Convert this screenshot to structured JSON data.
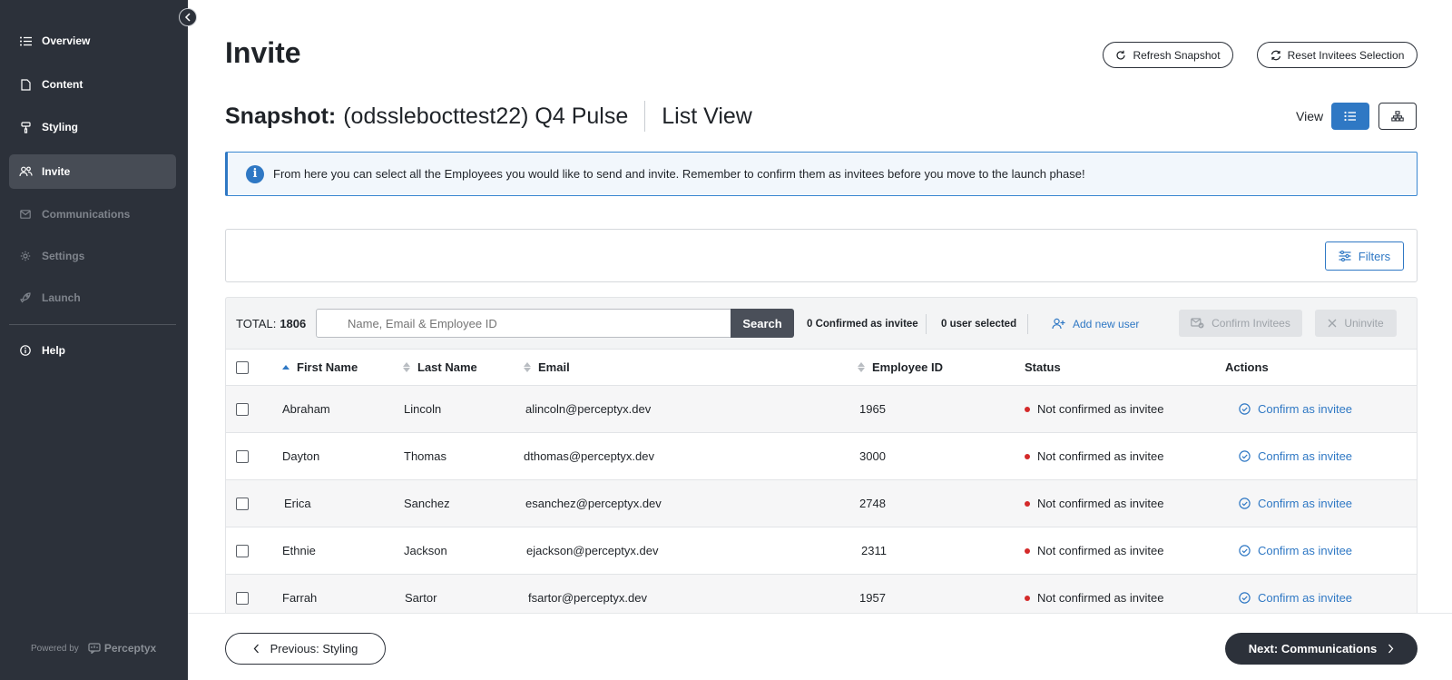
{
  "sidebar": {
    "items": [
      {
        "label": "Overview",
        "icon": "list-icon",
        "state": "normal"
      },
      {
        "label": "Content",
        "icon": "document-icon",
        "state": "normal"
      },
      {
        "label": "Styling",
        "icon": "paint-roller-icon",
        "state": "normal"
      },
      {
        "label": "Invite",
        "icon": "users-icon",
        "state": "active"
      },
      {
        "label": "Communications",
        "icon": "envelope-icon",
        "state": "disabled"
      },
      {
        "label": "Settings",
        "icon": "gear-icon",
        "state": "disabled"
      },
      {
        "label": "Launch",
        "icon": "rocket-icon",
        "state": "disabled"
      },
      {
        "label": "Help",
        "icon": "info-circle-icon",
        "state": "normal"
      }
    ],
    "powered_by": "Powered by",
    "brand": "Perceptyx"
  },
  "header": {
    "title": "Invite",
    "refresh_label": "Refresh Snapshot",
    "reset_label": "Reset Invitees Selection",
    "snapshot_prefix": "Snapshot:",
    "snapshot_name": "(odsslebocttest22) Q4 Pulse",
    "view_name": "List View",
    "view_label": "View"
  },
  "info": {
    "message": "From here you can select all the Employees you would like to send and invite. Remember to confirm them as invitees before you move to the launch phase!"
  },
  "filters": {
    "label": "Filters"
  },
  "toolbar": {
    "total_label": "TOTAL:",
    "total_value": "1806",
    "search_placeholder": "Name, Email & Employee ID",
    "search_label": "Search",
    "confirmed_count": "0 Confirmed as invitee",
    "selected_count": "0 user selected",
    "add_user_label": "Add new user",
    "confirm_invitees_label": "Confirm Invitees",
    "uninvite_label": "Uninvite"
  },
  "table": {
    "columns": {
      "first_name": "First Name",
      "last_name": "Last Name",
      "email": "Email",
      "employee_id": "Employee ID",
      "status": "Status",
      "actions": "Actions"
    },
    "rows": [
      {
        "first": "Abraham",
        "last": "Lincoln",
        "email": "alincoln@perceptyx.dev",
        "id": "1965",
        "status": "Not confirmed as invitee",
        "action": "Confirm as invitee"
      },
      {
        "first": "Dayton",
        "last": "Thomas",
        "email": "dthomas@perceptyx.dev",
        "id": "3000",
        "status": "Not confirmed as invitee",
        "action": "Confirm as invitee"
      },
      {
        "first": "Erica",
        "last": "Sanchez",
        "email": "esanchez@perceptyx.dev",
        "id": "2748",
        "status": "Not confirmed as invitee",
        "action": "Confirm as invitee"
      },
      {
        "first": "Ethnie",
        "last": "Jackson",
        "email": "ejackson@perceptyx.dev",
        "id": "2311",
        "status": "Not confirmed as invitee",
        "action": "Confirm as invitee"
      },
      {
        "first": "Farrah",
        "last": "Sartor",
        "email": "fsartor@perceptyx.dev",
        "id": "1957",
        "status": "Not confirmed as invitee",
        "action": "Confirm as invitee"
      }
    ]
  },
  "footer": {
    "prev_label": "Previous: Styling",
    "next_label": "Next: Communications"
  },
  "colors": {
    "sidebar_bg": "#2c313a",
    "accent": "#2f78c4",
    "status_red": "#d42a2a"
  }
}
